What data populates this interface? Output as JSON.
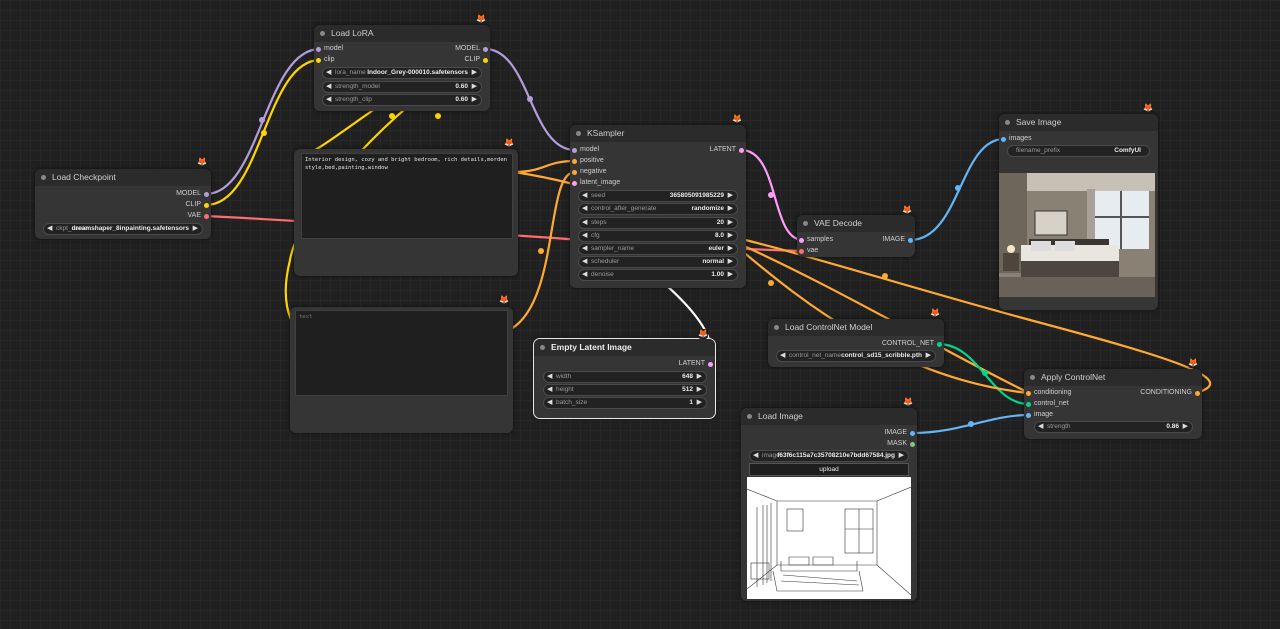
{
  "colors": {
    "model": "#b39ddb",
    "clip": "#ffd500",
    "vae": "#ff6e6e",
    "conditioning": "#ffa931",
    "latent": "#ff9cf9",
    "image": "#64b5f6",
    "control_net": "#00d78d",
    "mask": "#81c784"
  },
  "badge_icon": "fox-icon",
  "load_checkpoint": {
    "title": "Load Checkpoint",
    "outputs": [
      "MODEL",
      "CLIP",
      "VAE"
    ],
    "ckpt_label": "ckpt_name",
    "ckpt_value": "dreamshaper_8inpainting.safetensors"
  },
  "load_lora": {
    "title": "Load LoRA",
    "inputs": [
      "model",
      "clip"
    ],
    "outputs": [
      "MODEL",
      "CLIP"
    ],
    "widgets": [
      {
        "label": "lora_name",
        "value": "Indoor_Grey-000010.safetensors"
      },
      {
        "label": "strength_model",
        "value": "0.60"
      },
      {
        "label": "strength_clip",
        "value": "0.60"
      }
    ]
  },
  "prompt_positive": {
    "text": "Interior design, cozy and bright bedroom, rich details,morden style,bed,painting,window"
  },
  "prompt_negative": {
    "placeholder": "text"
  },
  "ksampler": {
    "title": "KSampler",
    "inputs": [
      "model",
      "positive",
      "negative",
      "latent_image"
    ],
    "output": "LATENT",
    "widgets": [
      {
        "label": "seed",
        "value": "365805091985229"
      },
      {
        "label": "control_after_generate",
        "value": "randomize"
      },
      {
        "label": "steps",
        "value": "20"
      },
      {
        "label": "cfg",
        "value": "8.0"
      },
      {
        "label": "sampler_name",
        "value": "euler"
      },
      {
        "label": "scheduler",
        "value": "normal"
      },
      {
        "label": "denoise",
        "value": "1.00"
      }
    ]
  },
  "empty_latent": {
    "title": "Empty Latent Image",
    "output": "LATENT",
    "widgets": [
      {
        "label": "width",
        "value": "648"
      },
      {
        "label": "height",
        "value": "512"
      },
      {
        "label": "batch_size",
        "value": "1"
      }
    ]
  },
  "vae_decode": {
    "title": "VAE Decode",
    "inputs": [
      "samples",
      "vae"
    ],
    "output": "IMAGE"
  },
  "save_image": {
    "title": "Save Image",
    "input": "images",
    "prefix_label": "filename_prefix",
    "prefix_value": "ComfyUI"
  },
  "load_controlnet": {
    "title": "Load ControlNet Model",
    "output": "CONTROL_NET",
    "label": "control_net_name",
    "value": "control_sd15_scribble.pth"
  },
  "apply_controlnet": {
    "title": "Apply ControlNet",
    "inputs": [
      "conditioning",
      "control_net",
      "image"
    ],
    "output": "CONDITIONING",
    "strength_label": "strength",
    "strength_value": "0.86"
  },
  "load_image": {
    "title": "Load Image",
    "outputs": [
      "IMAGE",
      "MASK"
    ],
    "image_label": "image",
    "image_value": "f63f6c115a7c35708210e7bdd67584.jpg",
    "upload_label": "upload"
  }
}
